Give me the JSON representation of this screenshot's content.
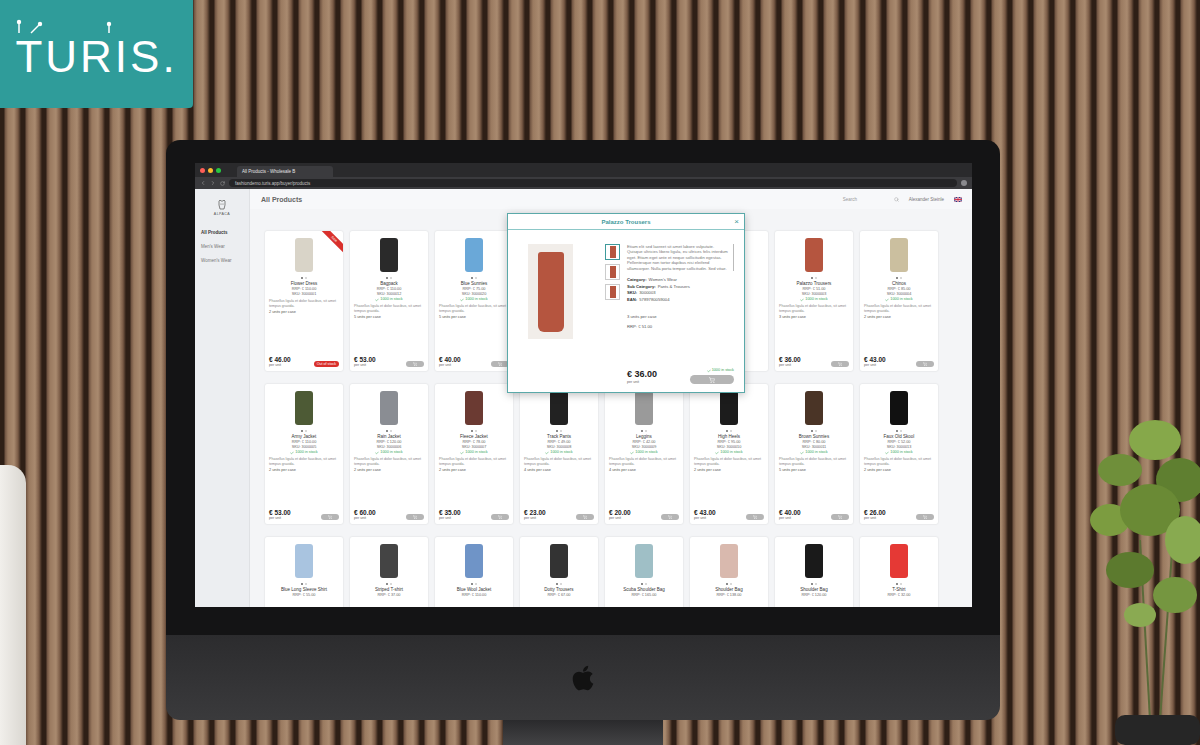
{
  "logo": {
    "text": "TURIS."
  },
  "browser": {
    "tab_title": "All Products - Wholesale B",
    "url": "fashiondemo.turis.app/buyer/products"
  },
  "app": {
    "brand": "ALPACA",
    "title": "All Products",
    "search": {
      "placeholder": "Search"
    },
    "user": "Alexander Steinle",
    "sidebar": {
      "items": [
        {
          "label": "All Products",
          "selected": true
        },
        {
          "label": "Men's Wear",
          "selected": false
        },
        {
          "label": "Women's Wear",
          "selected": false
        }
      ]
    }
  },
  "products": [
    {
      "kind": "full",
      "name": "Flower Dress",
      "rrp": "RRP: € 110.00",
      "sku": "SKU: 3000001",
      "description": "Phasellus ligula et dolor faucibus, sit amet tempus gravida.",
      "units": "2 units per case",
      "price": "€ 46.00",
      "per_unit": "per unit",
      "button": "Out of stock",
      "out_of_stock": true,
      "ribbon": "Sale",
      "color": "#d9d4c8"
    },
    {
      "kind": "full",
      "name": "Bagpack",
      "rrp": "RRP: € 110.00",
      "sku": "SKU: 3000012",
      "stock": "1000 in stock",
      "description": "Phasellus ligula et dolor faucibus, sit amet tempus gravida.",
      "units": "5 units per case",
      "price": "€ 53.00",
      "per_unit": "per unit",
      "out_of_stock": false,
      "color": "#2a2a2a"
    },
    {
      "kind": "full",
      "name": "Blue Sunnies",
      "rrp": "RRP: € 75.00",
      "sku": "SKU: 3000020",
      "stock": "1000 in stock",
      "description": "Phasellus ligula et dolor faucibus, sit amet tempus gravida.",
      "units": "5 units per case",
      "price": "€ 40.00",
      "per_unit": "per unit",
      "out_of_stock": false,
      "color": "#6aa8d8"
    },
    {
      "kind": "covered"
    },
    {
      "kind": "covered"
    },
    {
      "kind": "covered"
    },
    {
      "kind": "full",
      "name": "Palazzo Trousers",
      "rrp": "RRP: € 51.00",
      "sku": "SKU: 3000003",
      "stock": "1000 in stock",
      "description": "Phasellus ligula et dolor faucibus, sit amet tempus gravida.",
      "units": "3 units per case",
      "price": "€ 36.00",
      "per_unit": "per unit",
      "out_of_stock": false,
      "color": "#b5553f"
    },
    {
      "kind": "full",
      "name": "Chinos",
      "rrp": "RRP: € 85.00",
      "sku": "SKU: 3000004",
      "stock": "1000 in stock",
      "description": "Phasellus ligula et dolor faucibus, sit amet tempus gravida.",
      "units": "2 units per case",
      "price": "€ 43.00",
      "per_unit": "per unit",
      "out_of_stock": false,
      "color": "#cbbf9f"
    },
    {
      "kind": "full",
      "name": "Army Jacket",
      "rrp": "RRP: € 110.00",
      "sku": "SKU: 3000005",
      "stock": "1000 in stock",
      "description": "Phasellus ligula et dolor faucibus, sit amet tempus gravida.",
      "units": "2 units per case",
      "price": "€ 53.00",
      "per_unit": "per unit",
      "out_of_stock": false,
      "color": "#4d5a35"
    },
    {
      "kind": "full",
      "name": "Rain Jacket",
      "rrp": "RRP: € 120.00",
      "sku": "SKU: 3000006",
      "stock": "1000 in stock",
      "description": "Phasellus ligula et dolor faucibus, sit amet tempus gravida.",
      "units": "2 units per case",
      "price": "€ 60.00",
      "per_unit": "per unit",
      "out_of_stock": false,
      "color": "#8a8d93"
    },
    {
      "kind": "full",
      "name": "Fleece Jacket",
      "rrp": "RRP: € 78.00",
      "sku": "SKU: 3000007",
      "stock": "1000 in stock",
      "description": "Phasellus ligula et dolor faucibus, sit amet tempus gravida.",
      "units": "2 units per case",
      "price": "€ 35.00",
      "per_unit": "per unit",
      "out_of_stock": false,
      "color": "#6b3a32"
    },
    {
      "kind": "full",
      "name": "Track Pants",
      "rrp": "RRP: € 49.00",
      "sku": "SKU: 3000008",
      "stock": "1000 in stock",
      "description": "Phasellus ligula et dolor faucibus, sit amet tempus gravida.",
      "units": "4 units per case",
      "price": "€ 23.00",
      "per_unit": "per unit",
      "out_of_stock": false,
      "color": "#222222"
    },
    {
      "kind": "full",
      "name": "Leggins",
      "rrp": "RRP: € 42.00",
      "sku": "SKU: 3000009",
      "stock": "1000 in stock",
      "description": "Phasellus ligula et dolor faucibus, sit amet tempus gravida.",
      "units": "4 units per case",
      "price": "€ 20.00",
      "per_unit": "per unit",
      "out_of_stock": false,
      "color": "#9a9a9a"
    },
    {
      "kind": "full",
      "name": "High Heels",
      "rrp": "RRP: € 95.00",
      "sku": "SKU: 3000010",
      "stock": "1000 in stock",
      "description": "Phasellus ligula et dolor faucibus, sit amet tempus gravida.",
      "units": "2 units per case",
      "price": "€ 43.00",
      "per_unit": "per unit",
      "out_of_stock": false,
      "color": "#1c1c1c"
    },
    {
      "kind": "full",
      "name": "Brown Sunnies",
      "rrp": "RRP: € 80.00",
      "sku": "SKU: 3000011",
      "stock": "1000 in stock",
      "description": "Phasellus ligula et dolor faucibus, sit amet tempus gravida.",
      "units": "5 units per case",
      "price": "€ 40.00",
      "per_unit": "per unit",
      "out_of_stock": false,
      "color": "#4a3426"
    },
    {
      "kind": "full",
      "name": "Faux Old Skool",
      "rrp": "RRP: € 52.00",
      "sku": "SKU: 3000013",
      "stock": "1000 in stock",
      "description": "Phasellus ligula et dolor faucibus, sit amet tempus gravida.",
      "units": "2 units per case",
      "price": "€ 26.00",
      "per_unit": "per unit",
      "out_of_stock": false,
      "color": "#111111"
    },
    {
      "kind": "cut",
      "name": "Blue Long Sleeve Shirt",
      "rrp": "RRP: € 55.00",
      "color": "#a9c4e0"
    },
    {
      "kind": "cut",
      "name": "Striped T-shirt",
      "rrp": "RRP: € 37.00",
      "color": "#444444"
    },
    {
      "kind": "cut",
      "name": "Blue Wool Jacket",
      "rrp": "RRP: € 110.00",
      "color": "#6f94c7"
    },
    {
      "kind": "cut",
      "name": "Dotty Trousers",
      "rrp": "RRP: € 67.00",
      "color": "#333333"
    },
    {
      "kind": "cut",
      "name": "Scuba Shoulder Bag",
      "rrp": "RRP: € 165.00",
      "color": "#9fbfc6"
    },
    {
      "kind": "cut",
      "name": "Shoulder Bag",
      "rrp": "RRP: € 138.00",
      "color": "#d9b9ae"
    },
    {
      "kind": "cut",
      "name": "Shoulder Bag",
      "rrp": "RRP: € 120.00",
      "color": "#1a1a1a"
    },
    {
      "kind": "cut",
      "name": "T-Shirt",
      "rrp": "RRP: € 32.00",
      "color": "#e53935"
    }
  ],
  "modal": {
    "title": "Palazzo Trousers",
    "close": "×",
    "description": "Etiam elit sed laoreet sit amet labore vulputate. Quisque ultricies libero ligula, eu ultrices felis interdum eget. Etiam eget ante et neque sollicitudin egestas. Pellentesque non tortor dapibus nisi eleifend ullamcorper. Nulla porta tempor sollicitudin. Sed vitae.",
    "meta": [
      {
        "label": "Category:",
        "value": "Women's Wear"
      },
      {
        "label": "Sub Category:",
        "value": "Pants & Trousers"
      },
      {
        "label": "SKU:",
        "value": "3000003"
      },
      {
        "label": "EAN:",
        "value": "5789780059004"
      }
    ],
    "thumbnails": [
      {
        "selected": true
      },
      {
        "selected": false
      },
      {
        "selected": false
      }
    ],
    "units": "3 units per case",
    "rrp": "RRP: € 51.00",
    "price": "€ 36.00",
    "per_unit": "per unit",
    "stock": "1000 in stock",
    "color": "#b5553f"
  }
}
